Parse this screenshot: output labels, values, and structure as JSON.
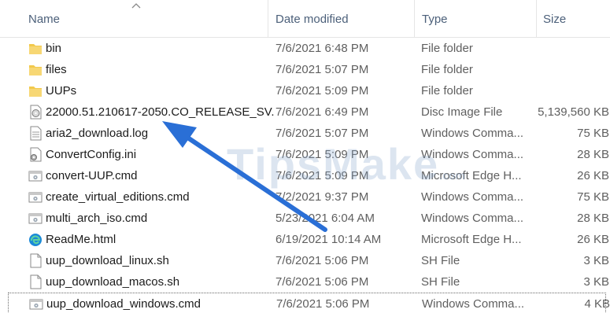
{
  "columns": {
    "name": "Name",
    "date": "Date modified",
    "type": "Type",
    "size": "Size"
  },
  "files": [
    {
      "icon": "folder-icon",
      "name": "bin",
      "date": "7/6/2021 6:48 PM",
      "type": "File folder",
      "size": ""
    },
    {
      "icon": "folder-icon",
      "name": "files",
      "date": "7/6/2021 5:07 PM",
      "type": "File folder",
      "size": ""
    },
    {
      "icon": "folder-icon",
      "name": "UUPs",
      "date": "7/6/2021 5:09 PM",
      "type": "File folder",
      "size": ""
    },
    {
      "icon": "disc-image-icon",
      "name": "22000.51.210617-2050.CO_RELEASE_SV...",
      "date": "7/6/2021 6:49 PM",
      "type": "Disc Image File",
      "size": "5,139,560 KB"
    },
    {
      "icon": "text-file-icon",
      "name": "aria2_download.log",
      "date": "7/6/2021 5:07 PM",
      "type": "Windows Comma...",
      "size": "75 KB"
    },
    {
      "icon": "settings-file-icon",
      "name": "ConvertConfig.ini",
      "date": "7/6/2021 5:09 PM",
      "type": "Windows Comma...",
      "size": "28 KB"
    },
    {
      "icon": "cmd-file-icon",
      "name": "convert-UUP.cmd",
      "date": "7/6/2021 5:09 PM",
      "type": "Microsoft Edge H...",
      "size": "26 KB"
    },
    {
      "icon": "cmd-file-icon",
      "name": "create_virtual_editions.cmd",
      "date": "7/2/2021 9:37 PM",
      "type": "Windows Comma...",
      "size": "75 KB"
    },
    {
      "icon": "cmd-file-icon",
      "name": "multi_arch_iso.cmd",
      "date": "5/23/2021 6:04 AM",
      "type": "Windows Comma...",
      "size": "28 KB"
    },
    {
      "icon": "edge-icon",
      "name": "ReadMe.html",
      "date": "6/19/2021 10:14 AM",
      "type": "Microsoft Edge H...",
      "size": "26 KB"
    },
    {
      "icon": "blank-file-icon",
      "name": "uup_download_linux.sh",
      "date": "7/6/2021 5:06 PM",
      "type": "SH File",
      "size": "3 KB"
    },
    {
      "icon": "blank-file-icon",
      "name": "uup_download_macos.sh",
      "date": "7/6/2021 5:06 PM",
      "type": "SH File",
      "size": "3 KB"
    },
    {
      "icon": "cmd-file-icon",
      "name": "uup_download_windows.cmd",
      "date": "7/6/2021 5:06 PM",
      "type": "Windows Comma...",
      "size": "4 KB"
    }
  ],
  "watermark": {
    "text": "TipsMake",
    "sub": ".com"
  },
  "colors": {
    "folder": "#f2c94c",
    "arrow": "#2a6fd6",
    "edge": "#1b8ad8"
  }
}
